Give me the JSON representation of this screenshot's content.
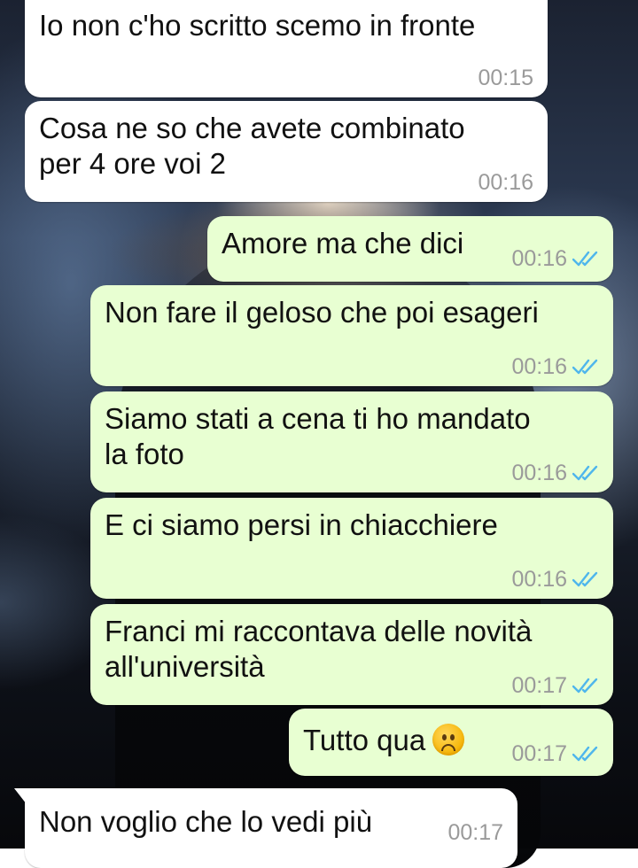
{
  "messages": [
    {
      "direction": "in",
      "lines": [
        "Io non c'ho scritto scemo in fronte"
      ],
      "time": "00:15"
    },
    {
      "direction": "in",
      "lines": [
        "Cosa ne so che avete combinato",
        "per 4 ore voi 2"
      ],
      "time": "00:16"
    },
    {
      "direction": "out",
      "lines": [
        "Amore ma che dici"
      ],
      "time": "00:16",
      "status": "read-double-check"
    },
    {
      "direction": "out",
      "lines": [
        "Non fare il geloso che poi esageri"
      ],
      "time": "00:16",
      "status": "read-double-check"
    },
    {
      "direction": "out",
      "lines": [
        "Siamo stati a cena ti ho mandato",
        "la foto"
      ],
      "time": "00:16",
      "status": "read-double-check"
    },
    {
      "direction": "out",
      "lines": [
        "E ci siamo persi in chiacchiere"
      ],
      "time": "00:16",
      "status": "read-double-check"
    },
    {
      "direction": "out",
      "lines": [
        "Franci mi raccontava delle novità",
        "all'università"
      ],
      "time": "00:17",
      "status": "read-double-check"
    },
    {
      "direction": "out",
      "lines": [
        "Tutto qua"
      ],
      "emoji": "frowning-face",
      "time": "00:17",
      "status": "read-double-check"
    },
    {
      "direction": "in",
      "lines": [
        "Non voglio che lo vedi più"
      ],
      "time": "00:17"
    }
  ],
  "colors": {
    "incoming_bubble": "#ffffff",
    "outgoing_bubble": "#e8ffd2",
    "read_tick": "#4fb6ec",
    "timestamp": "#9a9a9a"
  }
}
